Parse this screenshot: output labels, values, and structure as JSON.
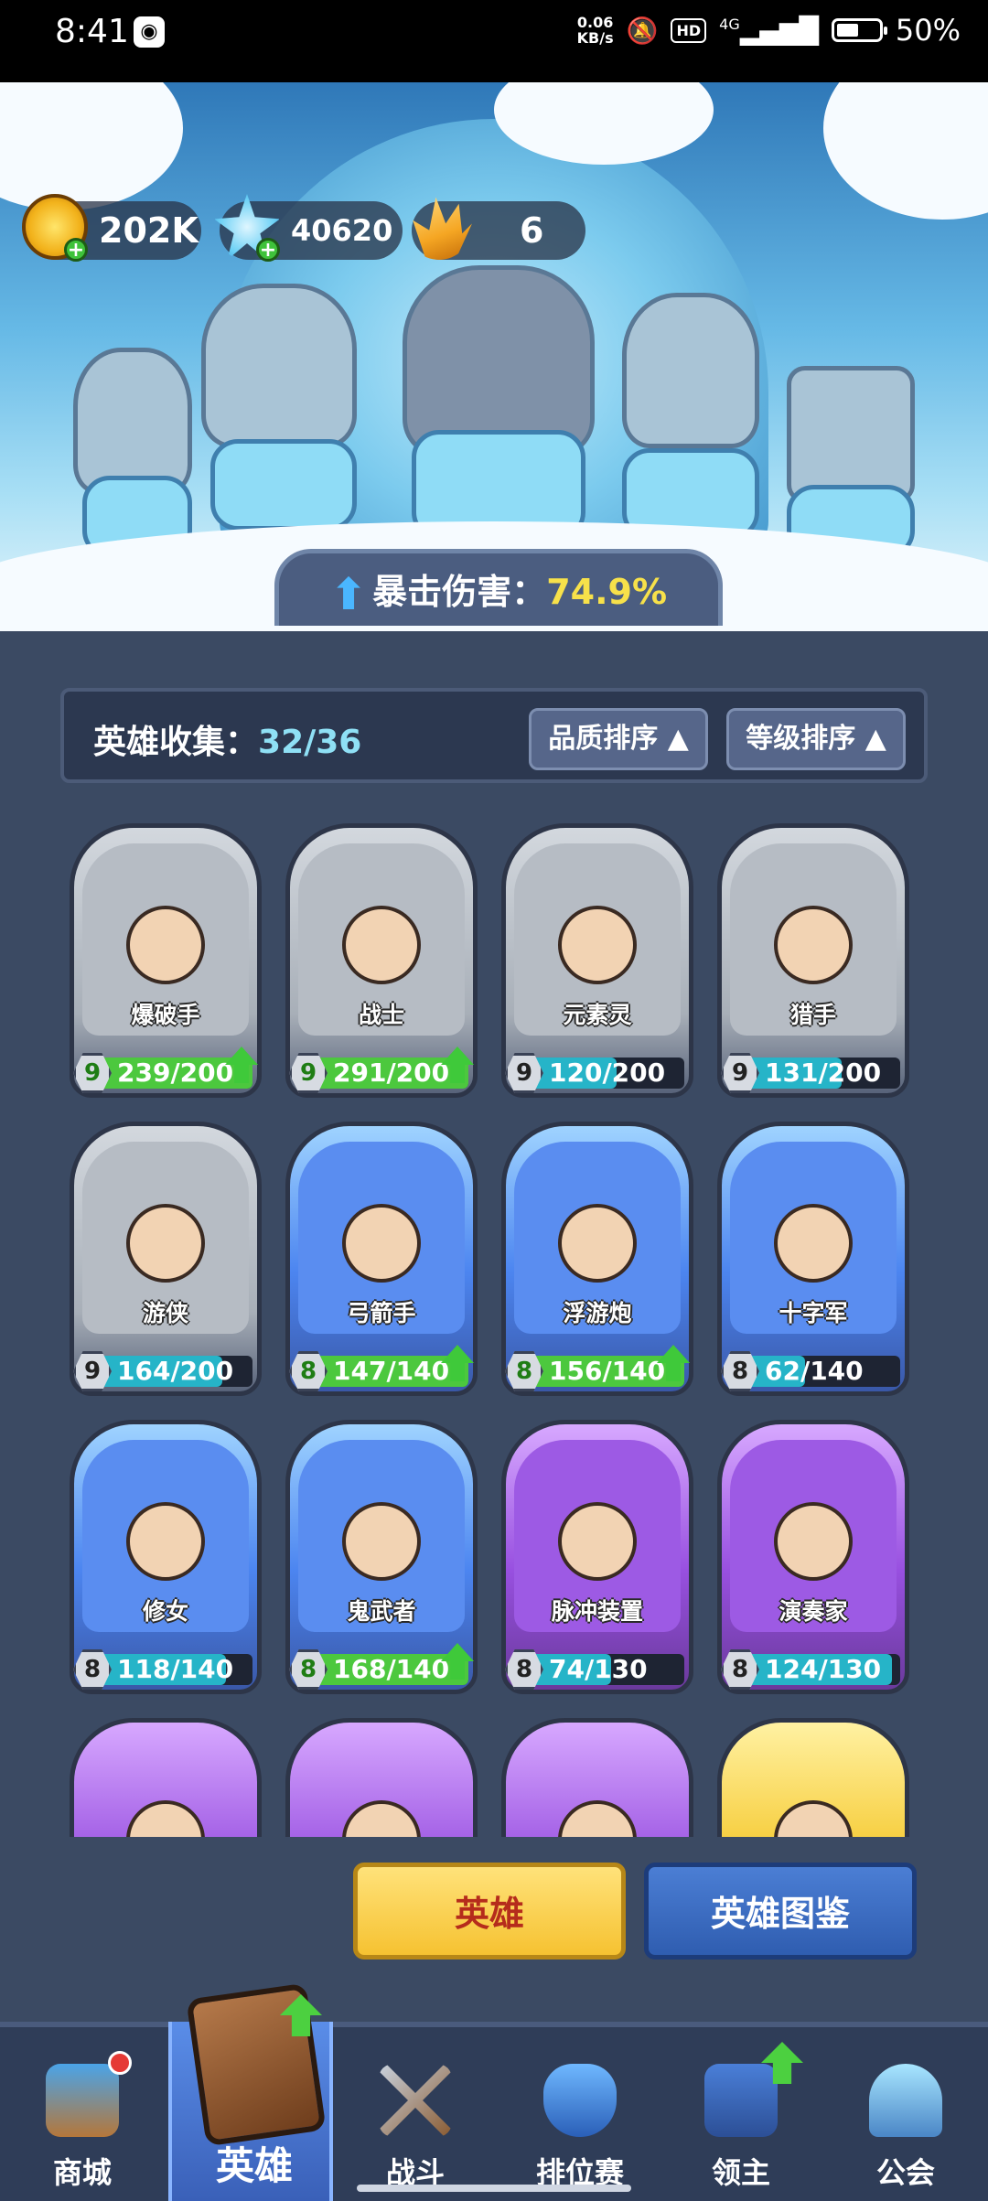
{
  "status_bar": {
    "time": "8:41",
    "net_speed_value": "0.06",
    "net_speed_unit": "KB/s",
    "hd": "HD",
    "network": "4G",
    "battery": "50%"
  },
  "resources": {
    "gold": "202K",
    "gems": "40620",
    "crystals": "6"
  },
  "crit": {
    "label": "暴击伤害：",
    "value": "74.9%"
  },
  "collection": {
    "label": "英雄收集：",
    "count": "32/36",
    "sort_quality": "品质排序",
    "sort_level": "等级排序",
    "sort_arrow": "▲"
  },
  "heroes": [
    {
      "name": "爆破手",
      "level": "9",
      "progress": "239/200",
      "fill": 1.0,
      "can_upgrade": true,
      "rarity": "gray"
    },
    {
      "name": "战士",
      "level": "9",
      "progress": "291/200",
      "fill": 1.0,
      "can_upgrade": true,
      "rarity": "gray"
    },
    {
      "name": "元素灵",
      "level": "9",
      "progress": "120/200",
      "fill": 0.6,
      "can_upgrade": false,
      "rarity": "gray"
    },
    {
      "name": "猎手",
      "level": "9",
      "progress": "131/200",
      "fill": 0.655,
      "can_upgrade": false,
      "rarity": "gray"
    },
    {
      "name": "游侠",
      "level": "9",
      "progress": "164/200",
      "fill": 0.82,
      "can_upgrade": false,
      "rarity": "gray"
    },
    {
      "name": "弓箭手",
      "level": "8",
      "progress": "147/140",
      "fill": 1.0,
      "can_upgrade": true,
      "rarity": "blue"
    },
    {
      "name": "浮游炮",
      "level": "8",
      "progress": "156/140",
      "fill": 1.0,
      "can_upgrade": true,
      "rarity": "blue"
    },
    {
      "name": "十字军",
      "level": "8",
      "progress": "62/140",
      "fill": 0.443,
      "can_upgrade": false,
      "rarity": "blue"
    },
    {
      "name": "修女",
      "level": "8",
      "progress": "118/140",
      "fill": 0.843,
      "can_upgrade": false,
      "rarity": "blue"
    },
    {
      "name": "鬼武者",
      "level": "8",
      "progress": "168/140",
      "fill": 1.0,
      "can_upgrade": true,
      "rarity": "blue"
    },
    {
      "name": "脉冲装置",
      "level": "8",
      "progress": "74/130",
      "fill": 0.569,
      "can_upgrade": false,
      "rarity": "purple"
    },
    {
      "name": "演奏家",
      "level": "8",
      "progress": "124/130",
      "fill": 0.954,
      "can_upgrade": false,
      "rarity": "purple"
    }
  ],
  "partial_cards": [
    "purple",
    "purple",
    "purple",
    "gold"
  ],
  "buttons": {
    "heroes": "英雄",
    "codex": "英雄图鉴"
  },
  "nav": [
    {
      "label": "商城",
      "icon": "shop-chest-icon"
    },
    {
      "label": "英雄",
      "icon": "hero-card-icon",
      "active": true
    },
    {
      "label": "战斗",
      "icon": "crossed-swords-icon"
    },
    {
      "label": "排位赛",
      "icon": "rank-shield-icon"
    },
    {
      "label": "领主",
      "icon": "lord-banner-icon"
    },
    {
      "label": "公会",
      "icon": "guild-castle-icon"
    }
  ],
  "colors": {
    "crit_value": "#f7e14a",
    "upgrade_green": "#4cc83e",
    "progress_cyan": "#26b4c8",
    "panel_bg": "#3b4a63"
  }
}
